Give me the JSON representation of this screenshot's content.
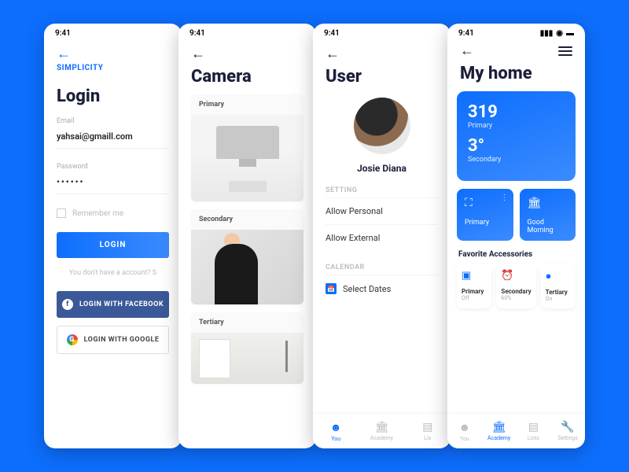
{
  "status_time": "9:41",
  "screen1": {
    "brand": "SIMPLICITY",
    "title": "Login",
    "email_label": "Email",
    "email_value": "yahsai@gmaill.com",
    "password_label": "Password",
    "password_value": "••••••",
    "remember": "Remember me",
    "login_btn": "LOGIN",
    "hint": "You don't have a account? S",
    "fb_btn": "LOGIN WITH FACEBOOK",
    "gg_btn": "LOGIN WITH GOOGLE"
  },
  "screen2": {
    "title": "Camera",
    "cam1": "Primary",
    "cam2": "Secondary",
    "cam3": "Tertiary"
  },
  "screen3": {
    "title": "User",
    "name": "Josie Diana",
    "section_setting": "SETTING",
    "allow_personal": "Allow Personal",
    "allow_external": "Allow External",
    "section_calendar": "CALENDAR",
    "select_dates": "Select Dates",
    "tab_you": "You",
    "tab_academy": "Academy",
    "tab_lists": "Lis"
  },
  "screen4": {
    "title": "My home",
    "card_num1": "319",
    "card_lbl1": "Primary",
    "card_num2": "3°",
    "card_lbl2": "Secondary",
    "mini1": "Primary",
    "mini2": "Good Morning",
    "fav_label": "Favorite Accessories",
    "acc1_t": "Primary",
    "acc1_s": "Off",
    "acc2_t": "Secondary",
    "acc2_s": "60%",
    "acc3_t": "Tertiary",
    "acc3_s": "On",
    "tab_you": "You",
    "tab_academy": "Academy",
    "tab_lists": "Lists",
    "tab_settings": "Settings"
  }
}
